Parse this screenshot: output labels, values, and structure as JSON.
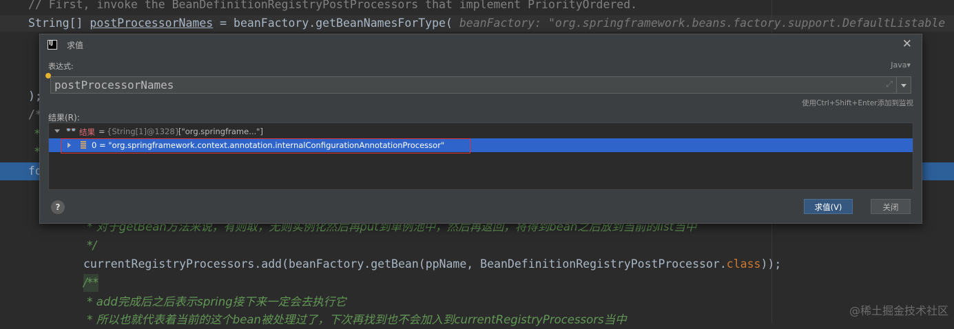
{
  "editor": {
    "line_top_comment": "// First, invoke the BeanDefinitionRegistryPostProcessors that implement PriorityOrdered.",
    "line_decl_type": "String[] ",
    "line_decl_var": "postProcessorNames",
    "line_decl_rest": " = beanFactory.getBeanNamesForType(",
    "line_decl_hint": "beanFactory: \"org.springframework.beans.factory.support.DefaultListable",
    "frag_close": ");",
    "frag_doc_open": "/*",
    "frag_star_1": "*",
    "frag_star_2": "*",
    "frag_for": "fo",
    "doc_line_1": " * 对于getBean方法来说，有则取，无则实例化然后再put到单例池中，然后再返回，将得到bean之后放到当前的list当中",
    "doc_line_2": " */",
    "code_line": "currentRegistryProcessors.add(beanFactory.getBean(ppName, BeanDefinitionRegistryPostProcessor.",
    "code_line_kw": "class",
    "code_line_end": "));",
    "doc2_open": "/**",
    "doc2_line_1": " * add完成后之后表示spring接下来一定会去执行它",
    "doc2_line_2": " * 所以也就代表着当前的这个bean被处理过了，下次再找到也不会加入到currentRegistryProcessors当中"
  },
  "watermark": "@稀土掘金技术社区",
  "dialog": {
    "title": "求值",
    "expression_label": "表达式:",
    "language": "Java▾",
    "expression_value": "postProcessorNames",
    "shortcut_hint": "使用Ctrl+Shift+Enter添加到监视",
    "result_label": "结果(R):",
    "tree": {
      "root_name": "结果",
      "root_eq": "=",
      "root_type": "{String[1]@1328}",
      "root_value": "[\"org.springframe...\"]",
      "child_text": "0 = \"org.springframework.context.annotation.internalConfigurationAnnotationProcessor\""
    },
    "help_label": "?",
    "evaluate_button": "求值(V)",
    "close_button": "关闭"
  },
  "colors": {
    "editor_bg": "#2b2b2b",
    "dialog_bg": "#3c3f41",
    "selection": "#2f65ca",
    "highlight_box": "#e0323a"
  }
}
